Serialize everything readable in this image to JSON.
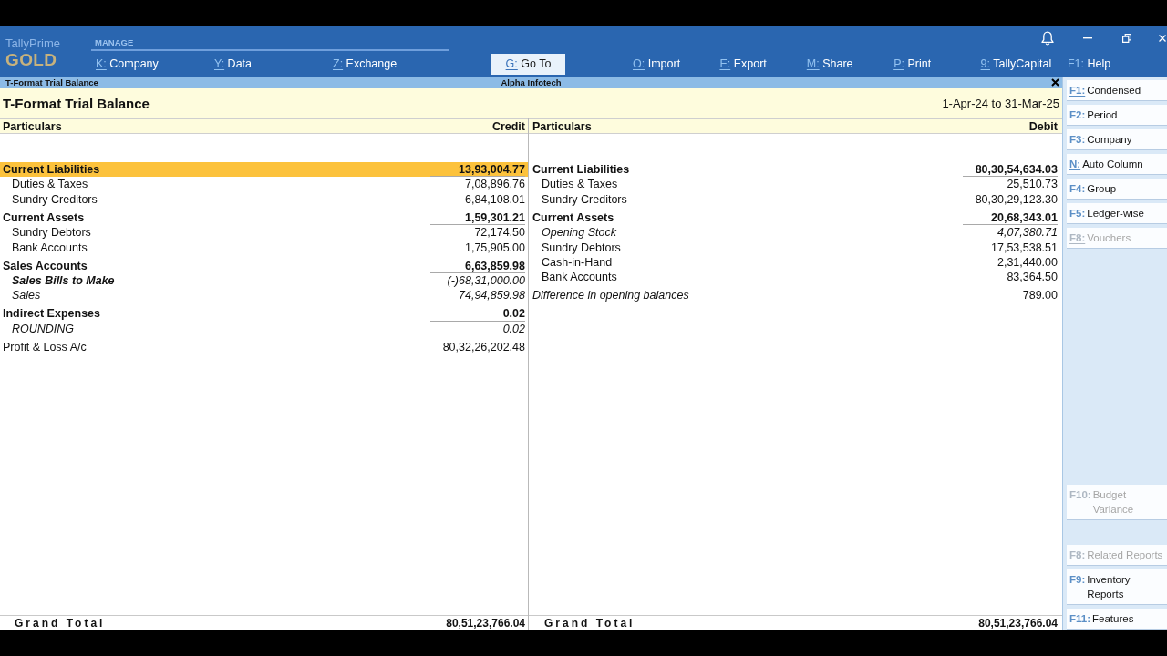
{
  "brand": {
    "product": "TallyPrime",
    "edition": "GOLD"
  },
  "manage": {
    "heading": "MANAGE",
    "items": [
      {
        "key": "K:",
        "label": "Company",
        "underlined": true
      },
      {
        "key": "Y:",
        "label": "Data",
        "underlined": true
      },
      {
        "key": "Z:",
        "label": "Exchange",
        "underlined": true
      }
    ]
  },
  "goto_button": {
    "key": "G:",
    "label": "Go To",
    "underlined": true
  },
  "actions": [
    {
      "key": "O:",
      "label": "Import",
      "underlined": true
    },
    {
      "key": "E:",
      "label": "Export",
      "underlined": true
    },
    {
      "key": "M:",
      "label": "Share",
      "underlined": true
    },
    {
      "key": "P:",
      "label": "Print",
      "underlined": true
    },
    {
      "key": "9:",
      "label": "TallyCapital",
      "underlined": true
    },
    {
      "key": "F1:",
      "label": "Help",
      "underlined": false
    }
  ],
  "report_bar": {
    "title": "T-Format Trial Balance",
    "company": "Alpha Infotech"
  },
  "report_header": {
    "title": "T-Format Trial Balance",
    "period": "1-Apr-24 to 31-Mar-25"
  },
  "sides": [
    {
      "columns": [
        "Particulars",
        "Credit"
      ],
      "rows": [
        {
          "name": "Current Liabilities",
          "amount": "13,93,004.77",
          "kind": "group",
          "selected": true,
          "children": [
            {
              "name": "Duties & Taxes",
              "amount": "7,08,896.76",
              "kind": "ledger",
              "selected": false
            },
            {
              "name": "Sundry Creditors",
              "amount": "6,84,108.01",
              "kind": "ledger",
              "selected": false
            }
          ]
        },
        {
          "name": "Current Assets",
          "amount": "1,59,301.21",
          "kind": "group",
          "selected": false,
          "children": [
            {
              "name": "Sundry Debtors",
              "amount": "72,174.50",
              "kind": "ledger",
              "selected": false
            },
            {
              "name": "Bank Accounts",
              "amount": "1,75,905.00",
              "kind": "ledger",
              "selected": false
            }
          ]
        },
        {
          "name": "Sales Accounts",
          "amount": "6,63,859.98",
          "kind": "group",
          "selected": false,
          "children": [
            {
              "name": "Sales Bills to Make",
              "amount": "(-)68,31,000.00",
              "kind": "italic_group",
              "selected": false
            },
            {
              "name": "Sales",
              "amount": "74,94,859.98",
              "kind": "italic_ledger",
              "selected": false
            }
          ]
        },
        {
          "name": "Indirect Expenses",
          "amount": "0.02",
          "kind": "group",
          "selected": false,
          "children": [
            {
              "name": "ROUNDING",
              "amount": "0.02",
              "kind": "italic_ledger",
              "selected": false
            }
          ]
        },
        {
          "name": "Profit & Loss A/c",
          "amount": "80,32,26,202.48",
          "kind": "ledger",
          "selected": false
        }
      ],
      "grand_total": {
        "label": "Grand Total",
        "amount": "80,51,23,766.04"
      }
    },
    {
      "columns": [
        "Particulars",
        "Debit"
      ],
      "rows": [
        {
          "name": "Current Liabilities",
          "amount": "80,30,54,634.03",
          "kind": "group",
          "selected": false,
          "children": [
            {
              "name": "Duties & Taxes",
              "amount": "25,510.73",
              "kind": "ledger",
              "selected": false
            },
            {
              "name": "Sundry Creditors",
              "amount": "80,30,29,123.30",
              "kind": "ledger",
              "selected": false
            }
          ]
        },
        {
          "name": "Current Assets",
          "amount": "20,68,343.01",
          "kind": "group",
          "selected": false,
          "children": [
            {
              "name": "Opening Stock",
              "amount": "4,07,380.71",
              "kind": "italic_ledger",
              "selected": false
            },
            {
              "name": "Sundry Debtors",
              "amount": "17,53,538.51",
              "kind": "ledger",
              "selected": false
            },
            {
              "name": "Cash-in-Hand",
              "amount": "2,31,440.00",
              "kind": "ledger",
              "selected": false
            },
            {
              "name": "Bank Accounts",
              "amount": "83,364.50",
              "kind": "ledger",
              "selected": false
            }
          ]
        },
        {
          "name": "Difference in opening balances",
          "amount": "789.00",
          "kind": "italic_note",
          "selected": false
        }
      ],
      "grand_total": {
        "label": "Grand Total",
        "amount": "80,51,23,766.04"
      }
    }
  ],
  "sidebar": {
    "sections": [
      {
        "buttons": [
          {
            "key": "F1:",
            "label": "Condensed",
            "underlined": true,
            "disabled": false
          },
          {
            "key": "F2:",
            "label": "Period",
            "underlined": false,
            "disabled": false
          },
          {
            "key": "F3:",
            "label": "Company",
            "underlined": false,
            "disabled": false
          },
          {
            "key": "N:",
            "label": "Auto Column",
            "underlined": true,
            "disabled": false
          },
          {
            "key": "F4:",
            "label": "Group",
            "underlined": false,
            "disabled": false
          },
          {
            "key": "F5:",
            "label": "Ledger-wise",
            "underlined": false,
            "disabled": false
          },
          {
            "key": "F8:",
            "label": "Vouchers",
            "underlined": true,
            "disabled": true
          }
        ]
      },
      {
        "buttons": [
          {
            "key": "F10:",
            "label": "Budget\nVariance",
            "underlined": false,
            "disabled": true
          }
        ]
      },
      {
        "buttons": [
          {
            "key": "F8:",
            "label": "Related Reports",
            "underlined": false,
            "disabled": true
          },
          {
            "key": "F9:",
            "label": "Inventory\nReports",
            "underlined": false,
            "disabled": false
          },
          {
            "key": "F11:",
            "label": "Features",
            "underlined": false,
            "disabled": false
          }
        ]
      }
    ]
  }
}
